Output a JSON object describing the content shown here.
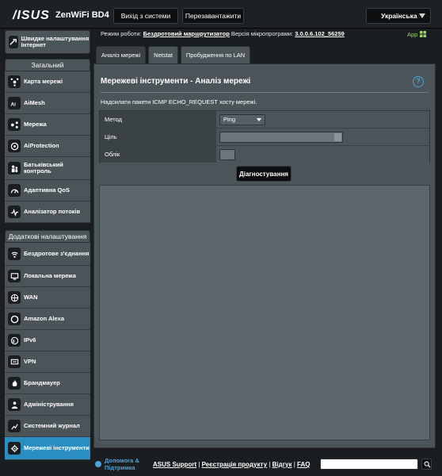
{
  "header": {
    "logo": "/ISUS",
    "model": "ZenWiFi BD4",
    "logout_label": "Вихід з системи",
    "reboot_label": "Перезавантажити",
    "language": "Українська"
  },
  "status": {
    "mode_label": "Режим роботи:",
    "mode_value": "Бездротовий маршрутизатор",
    "firmware_label": "Версія мікропрограми:",
    "firmware_value": "3.0.0.6.102_56259",
    "app_label": "App"
  },
  "sidebar": {
    "quick_setup": "Швидке налаштування Інтернет",
    "general_title": "Загальний",
    "general_items": [
      {
        "label": "Карта мережі",
        "icon": "network-map-icon"
      },
      {
        "label": "AiMesh",
        "icon": "aimesh-icon"
      },
      {
        "label": "Мережа",
        "icon": "network-icon"
      },
      {
        "label": "AiProtection",
        "icon": "aiprotection-icon"
      },
      {
        "label": "Батьківський контроль",
        "icon": "parental-control-icon"
      },
      {
        "label": "Адаптивна QoS",
        "icon": "qos-icon"
      },
      {
        "label": "Аналізатор потоків",
        "icon": "traffic-analyzer-icon"
      }
    ],
    "advanced_title": "Додаткові налаштування",
    "advanced_items": [
      {
        "label": "Бездротове з'єднання",
        "icon": "wireless-icon"
      },
      {
        "label": "Локальна мережа",
        "icon": "lan-icon"
      },
      {
        "label": "WAN",
        "icon": "wan-icon"
      },
      {
        "label": "Amazon Alexa",
        "icon": "alexa-icon"
      },
      {
        "label": "IPv6",
        "icon": "ipv6-icon"
      },
      {
        "label": "VPN",
        "icon": "vpn-icon"
      },
      {
        "label": "Брандмауер",
        "icon": "firewall-icon"
      },
      {
        "label": "Адміністрування",
        "icon": "administration-icon"
      },
      {
        "label": "Системний журнал",
        "icon": "system-log-icon"
      },
      {
        "label": "Мережеві інструменти",
        "icon": "network-tools-icon",
        "active": true
      }
    ]
  },
  "tabs": [
    {
      "label": "Аналіз мережі",
      "active": true
    },
    {
      "label": "Netstat",
      "active": false
    },
    {
      "label": "Пробудження по LAN",
      "active": false
    }
  ],
  "main": {
    "title": "Мережеві інструменти - Аналіз мережі",
    "description": "Надсилати пакети ICMP ECHO_REQUEST хосту мережі.",
    "method_label": "Метод",
    "method_value": "Ping",
    "target_label": "Ціль",
    "target_value": "",
    "count_label": "Облік",
    "count_value": "",
    "diagnose_label": "Діагностування"
  },
  "footer": {
    "help_label": "Допомога & Підтримка",
    "links": [
      "ASUS Support",
      "Реєстрація продукту",
      "Відгук",
      "FAQ"
    ],
    "search_placeholder": ""
  },
  "colors": {
    "accent": "#2a8ec2",
    "panel": "#4b5459",
    "background": "#1b1e20"
  }
}
